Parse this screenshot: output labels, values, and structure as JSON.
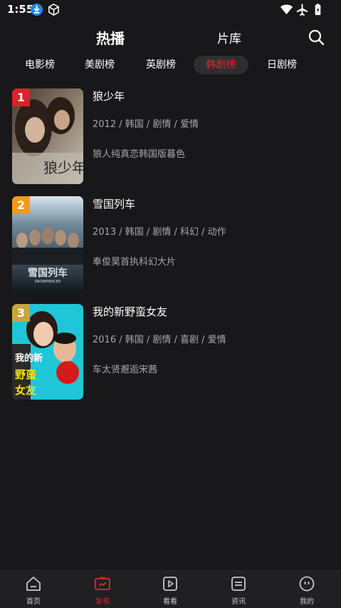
{
  "status": {
    "time": "1:55"
  },
  "header": {
    "tab_hot": "热播",
    "tab_library": "片库"
  },
  "rank_tabs": [
    {
      "label": "电影榜",
      "active": false
    },
    {
      "label": "美剧榜",
      "active": false
    },
    {
      "label": "英剧榜",
      "active": false
    },
    {
      "label": "韩剧榜",
      "active": true
    },
    {
      "label": "日剧榜",
      "active": false
    }
  ],
  "items": [
    {
      "rank": "1",
      "title": "狼少年",
      "meta": "2012 / 韩国 / 剧情 / 爱情",
      "desc": "狼人纯真恋韩国版暮色",
      "poster_text": "狼少年",
      "badge_color": "#e0202a"
    },
    {
      "rank": "2",
      "title": "雪国列车",
      "meta": "2013 / 韩国 / 剧情 / 科幻 / 动作",
      "desc": "奉俊昊首执科幻大片",
      "poster_text": "雪国列车",
      "poster_subtext": "SNOWPIERCER",
      "badge_color": "#f39a1c"
    },
    {
      "rank": "3",
      "title": "我的新野蛮女友",
      "meta": "2016 / 韩国 / 剧情 / 喜剧 / 爱情",
      "desc": "车太贤邂逅宋茜",
      "poster_text_a": "我的新",
      "poster_text_b": "野蛮",
      "poster_text_c": "女友",
      "badge_color": "#c8a43c"
    }
  ],
  "bottom_nav": [
    {
      "label": "首页",
      "icon": "home-icon",
      "active": false
    },
    {
      "label": "发现",
      "icon": "video-icon",
      "active": true
    },
    {
      "label": "看看",
      "icon": "play-icon",
      "active": false
    },
    {
      "label": "资讯",
      "icon": "news-icon",
      "active": false
    },
    {
      "label": "我的",
      "icon": "profile-icon",
      "active": false
    }
  ],
  "colors": {
    "accent": "#e2252d",
    "background": "#18181a",
    "nav_background": "#202022"
  }
}
